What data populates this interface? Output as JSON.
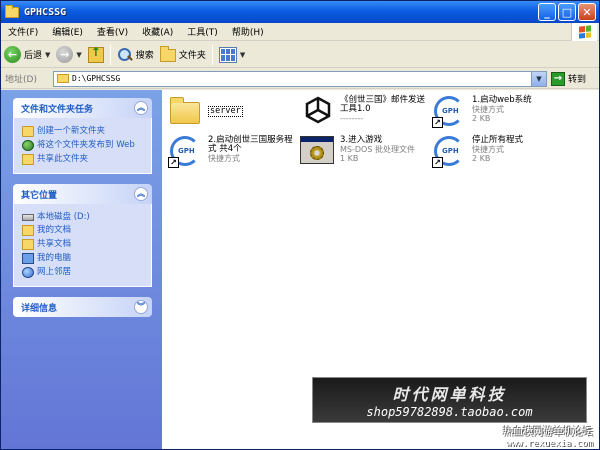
{
  "window": {
    "title": "GPHCSSG",
    "buttons": {
      "minimize": "_",
      "maximize": "□",
      "close": "✕"
    }
  },
  "menu": [
    "文件(F)",
    "编辑(E)",
    "查看(V)",
    "收藏(A)",
    "工具(T)",
    "帮助(H)"
  ],
  "toolbar": {
    "back": "后退",
    "search": "搜索",
    "folders": "文件夹"
  },
  "address": {
    "label": "地址(D)",
    "path": "D:\\GPHCSSG",
    "go": "转到"
  },
  "taskpane": {
    "file_tasks": {
      "title": "文件和文件夹任务",
      "items": [
        "创建一个新文件夹",
        "将这个文件夹发布到 Web",
        "共享此文件夹"
      ]
    },
    "other_places": {
      "title": "其它位置",
      "items": [
        "本地磁盘 (D:)",
        "我的文档",
        "共享文档",
        "我的电脑",
        "网上邻居"
      ]
    },
    "details": {
      "title": "详细信息"
    }
  },
  "files": [
    {
      "name": "server",
      "type": "",
      "size": "",
      "icon": "folder-icon"
    },
    {
      "name": "《创世三国》邮件发送工具1.0",
      "type": "--------",
      "size": "",
      "icon": "unity-icon"
    },
    {
      "name": "1.启动web系统",
      "type": "快捷方式",
      "size": "2 KB",
      "icon": "gph-shortcut-icon"
    },
    {
      "name": "2.启动创世三国服务程式 共4个",
      "type": "快捷方式",
      "size": "",
      "icon": "gph-shortcut-icon"
    },
    {
      "name": "3.进入游戏",
      "type": "MS-DOS 批处理文件",
      "size": "1 KB",
      "icon": "batch-file-icon"
    },
    {
      "name": "停止所有程式",
      "type": "快捷方式",
      "size": "2 KB",
      "icon": "gph-shortcut-icon"
    }
  ],
  "watermark": {
    "title": "时代网单科技",
    "url": "shop59782898.taobao.com",
    "forum": "热血模网游单机论坛",
    "site": "www.rexuexia.com"
  }
}
